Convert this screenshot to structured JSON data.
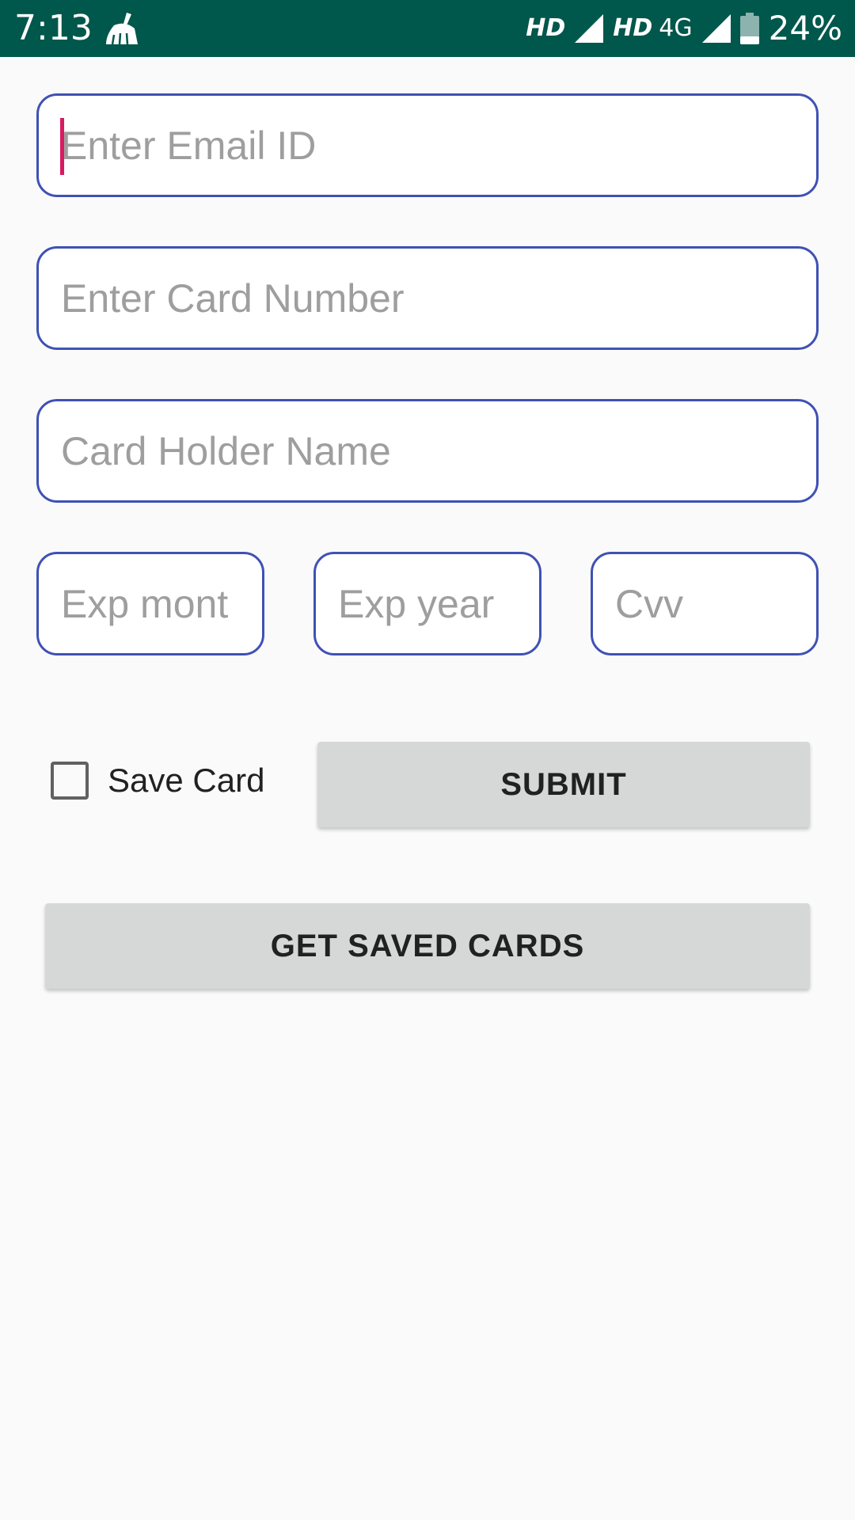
{
  "status_bar": {
    "time": "7:13",
    "hd_1": "HD",
    "hd_2": "HD",
    "network": "4G",
    "battery": "24%",
    "icons": [
      "cleaner-icon",
      "signal-icon",
      "battery-icon"
    ]
  },
  "form": {
    "email_placeholder": "Enter Email ID",
    "card_number_placeholder": "Enter Card Number",
    "card_holder_placeholder": "Card Holder Name",
    "exp_month_placeholder": "Exp mont",
    "exp_year_placeholder": "Exp year",
    "cvv_placeholder": "Cvv",
    "save_card_label": "Save Card",
    "save_card_checked": false
  },
  "buttons": {
    "submit": "SUBMIT",
    "get_saved_cards": "GET SAVED CARDS"
  },
  "colors": {
    "status_bar": "#00574b",
    "field_border": "#3f51b5",
    "caret": "#d81b60",
    "button_bg": "#d6d7d7",
    "background": "#fafafa"
  }
}
